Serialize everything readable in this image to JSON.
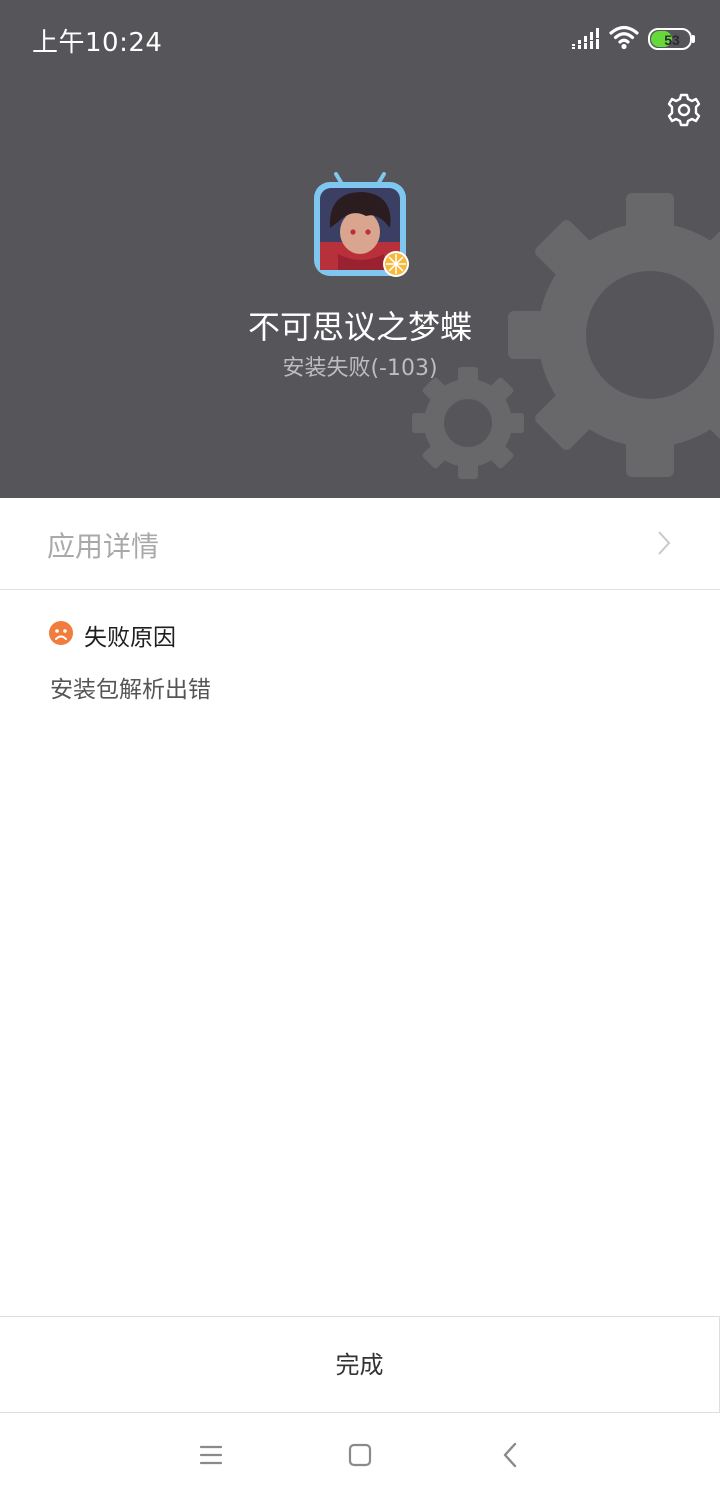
{
  "status_bar": {
    "time": "上午10:24",
    "battery_level": "53",
    "icons": [
      "signal-icon",
      "wifi-icon",
      "battery-icon"
    ]
  },
  "header": {
    "settings_icon": "gear-icon",
    "app_name": "不可思议之梦蝶",
    "install_status": "安装失败(-103)"
  },
  "details": {
    "label": "应用详情",
    "icon": "chevron-right-icon"
  },
  "failure": {
    "icon": "sad-face-icon",
    "title": "失败原因",
    "reason": "安装包解析出错"
  },
  "actions": {
    "done_label": "完成"
  },
  "nav_bar": {
    "icons": [
      "menu-icon",
      "home-icon",
      "back-icon"
    ]
  },
  "colors": {
    "header_bg": "#55555a",
    "battery_fill": "#66d93a",
    "failure_icon": "#f07c3e",
    "muted_text": "#a9a9a9"
  }
}
